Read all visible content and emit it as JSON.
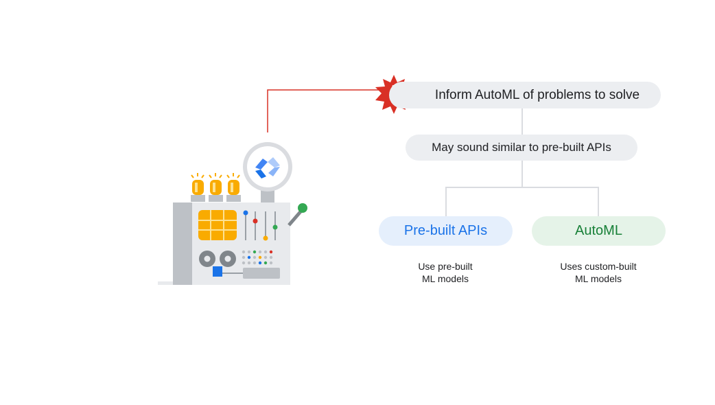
{
  "diagram": {
    "top_node": {
      "label": "Inform AutoML of problems to solve",
      "icon": "alert-icon"
    },
    "middle_node": {
      "label": "May sound similar to pre-built APIs"
    },
    "options": [
      {
        "label": "Pre-built APIs",
        "caption_line1": "Use pre-built",
        "caption_line2": "ML models",
        "color": "#1a73e8",
        "background": "#e5effc"
      },
      {
        "label": "AutoML",
        "caption_line1": "Uses custom-built",
        "caption_line2": "ML models",
        "color": "#188038",
        "background": "#e5f3e8"
      }
    ],
    "illustration": {
      "name": "automl-machine-illustration",
      "logo": "vertex-ai-logo-icon"
    },
    "colors": {
      "connector_red": "#d93025",
      "connector_gray": "#dadce0",
      "alert_red": "#d93025"
    }
  }
}
